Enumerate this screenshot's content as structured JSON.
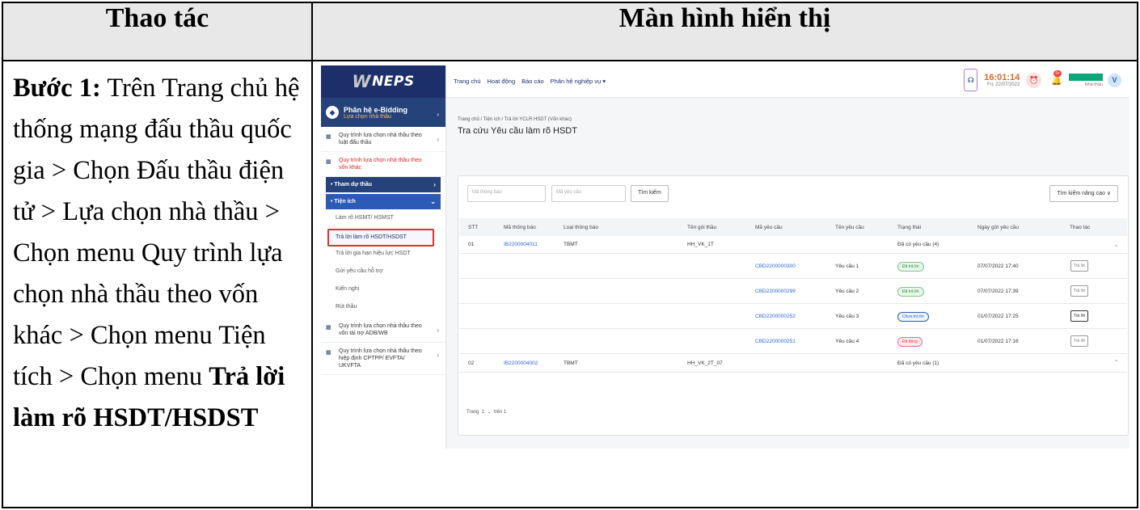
{
  "table": {
    "col_left_header": "Thao tác",
    "col_right_header": "Màn hình hiển thị",
    "step_label": "Bước 1:",
    "step_text": " Trên Trang chủ hệ thống mạng đấu thầu quốc gia > Chọn Đấu thầu điện tử > Lựa chọn nhà thầu > Chọn menu Quy trình lựa chọn nhà thầu theo vốn khác > Chọn menu Tiện tích > Chọn menu ",
    "step_bold_end": "Trả lời làm rõ HSDT/HSDST"
  },
  "app": {
    "logo": "NEPS",
    "module_title": "Phân hệ e-Bidding",
    "module_subtitle": "Lựa chọn nhà thầu",
    "menu": [
      {
        "label": "Quy trình lựa chọn nhà thầu theo luật đấu thầu"
      },
      {
        "label": "Quy trình lựa chọn nhà thầu theo vốn khác"
      }
    ],
    "nav_tham_du": "Tham dự thầu",
    "nav_tien_ich": "Tiện ích",
    "sub_items": [
      "Làm rõ HSMT/ HSMST",
      "Trả lời làm rõ HSDT/HSDST",
      "Trả lời gia hạn hiệu lực HSDT",
      "Gửi yêu cầu hỗ trợ",
      "Kiến nghị",
      "Rút thầu"
    ],
    "menu_bottom": [
      {
        "label": "Quy trình lựa chọn nhà thầu theo vốn tài trợ ADB/WB"
      },
      {
        "label": "Quy trình lựa chọn nhà thầu theo hiệp định CPTPP/ EVFTA/ UKVFTA"
      }
    ],
    "topnav": [
      "Trang chủ",
      "Hoạt động",
      "Báo cáo",
      "Phân hệ nghiệp vụ ▾"
    ],
    "time": "16:01:14",
    "date": "Fri, 22/07/2022",
    "notif_count": "9+",
    "user_role": "Nhà thầu",
    "avatar_letter": "V",
    "breadcrumb": "Trang chủ  /  Tiện ích  /  Trả lời YCLR HSDT (Vốn khác)",
    "page_title": "Tra cứu Yêu cầu làm rõ HSDT",
    "search": {
      "ph_notice": "Mã thông báo",
      "ph_request": "Mã yêu cầu",
      "btn_search": "Tìm kiếm",
      "btn_advanced": "Tìm kiếm nâng cao  ∨"
    },
    "columns": [
      "STT",
      "Mã thông báo",
      "Loại thông báo",
      "Tên gói thầu",
      "Mã yêu cầu",
      "Tên yêu cầu",
      "Trạng thái",
      "Ngày gửi yêu cầu",
      "Thao tác"
    ],
    "groups": [
      {
        "stt": "01",
        "notice": "IB2200004011",
        "type": "TBMT",
        "package": "HH_VK_1T",
        "status": "Đã có yêu cầu (4)"
      },
      {
        "stt": "02",
        "notice": "IB2200004002",
        "type": "TBMT",
        "package": "HH_VK_2T_07",
        "status": "Đã có yêu cầu (1)"
      }
    ],
    "requests": [
      {
        "code": "CBD2200000300",
        "name": "Yêu cầu 1",
        "status": "Đã trả lời",
        "date": "07/07/2022 17:40",
        "action": "Trả lời"
      },
      {
        "code": "CBD2200000299",
        "name": "Yêu cầu 2",
        "status": "Đã trả lời",
        "date": "07/07/2022 17:39",
        "action": "Trả lời"
      },
      {
        "code": "CBD2200000252",
        "name": "Yêu cầu 3",
        "status": "Chưa trả lời",
        "date": "01/07/2022 17:25",
        "action": "Trả lời"
      },
      {
        "code": "CBD2200000251",
        "name": "Yêu cầu 4",
        "status": "Đã đóng",
        "date": "01/07/2022 17:16",
        "action": "Trả lời"
      }
    ],
    "pager_label": "Trang",
    "pager_page": "1",
    "pager_total": "trên 1"
  }
}
